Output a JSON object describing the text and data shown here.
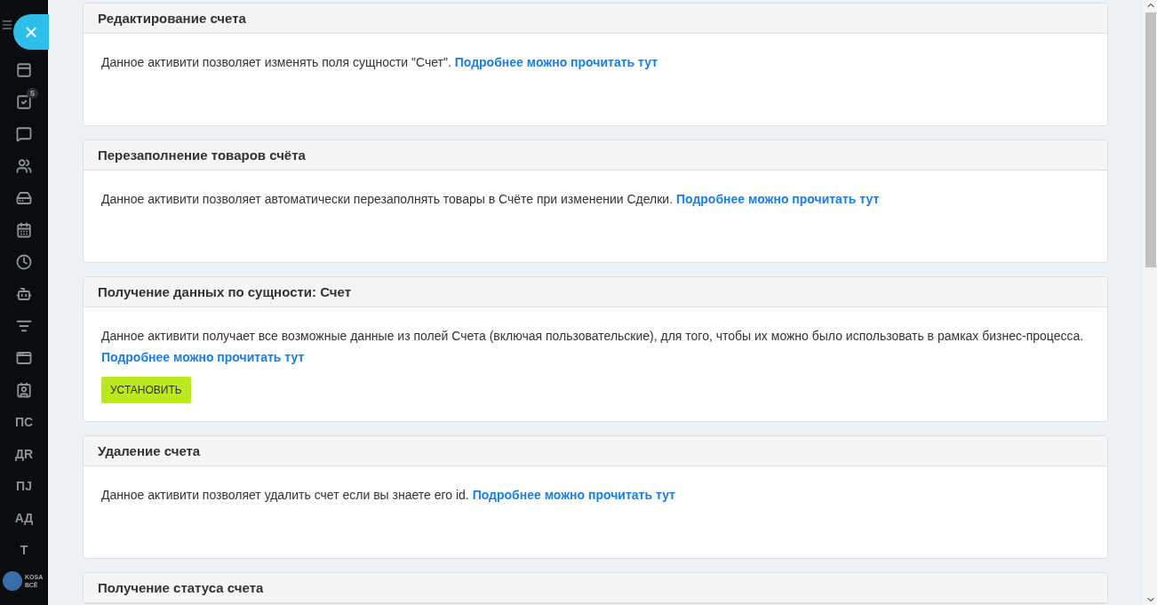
{
  "sidebar": {
    "close_button": "×",
    "items": [
      {
        "kind": "icon"
      },
      {
        "kind": "icon",
        "badge": "5"
      },
      {
        "kind": "icon"
      },
      {
        "kind": "icon"
      },
      {
        "kind": "icon"
      },
      {
        "kind": "icon"
      },
      {
        "kind": "icon"
      },
      {
        "kind": "icon"
      },
      {
        "kind": "icon"
      },
      {
        "kind": "icon"
      },
      {
        "kind": "icon"
      },
      {
        "kind": "text",
        "label": "ПС"
      },
      {
        "kind": "text",
        "label": "ДR"
      },
      {
        "kind": "text",
        "label": "ПЈ"
      },
      {
        "kind": "text",
        "label": "АД"
      },
      {
        "kind": "text",
        "label": "Т"
      }
    ],
    "logo": {
      "line_1": "KOSA",
      "line_2": "ВСЁ"
    }
  },
  "cards": [
    {
      "title": "Редактирование счета",
      "text": "Данное активити позволяет изменять поля сущности \"Счет\".",
      "link": "Подробнее можно прочитать тут"
    },
    {
      "title": "Перезаполнение товаров счёта",
      "text": "Данное активити позволяет автоматически перезаполнять товары в Счёте при изменении Сделки.",
      "link": "Подробнее можно прочитать тут"
    },
    {
      "title": "Получение данных по сущности: Счет",
      "text": "Данное активити получает все возможные данные из полей Счета (включая пользовательские), для того, чтобы их можно было использовать в рамках бизнес-процесса.",
      "link": "Подробнее можно прочитать тут",
      "button": "УСТАНОВИТЬ"
    },
    {
      "title": "Удаление счета",
      "text": "Данное активити позволяет удалить счет если вы знаете его id.",
      "link": "Подробнее можно прочитать тут"
    },
    {
      "title": "Получение статуса счета"
    }
  ]
}
